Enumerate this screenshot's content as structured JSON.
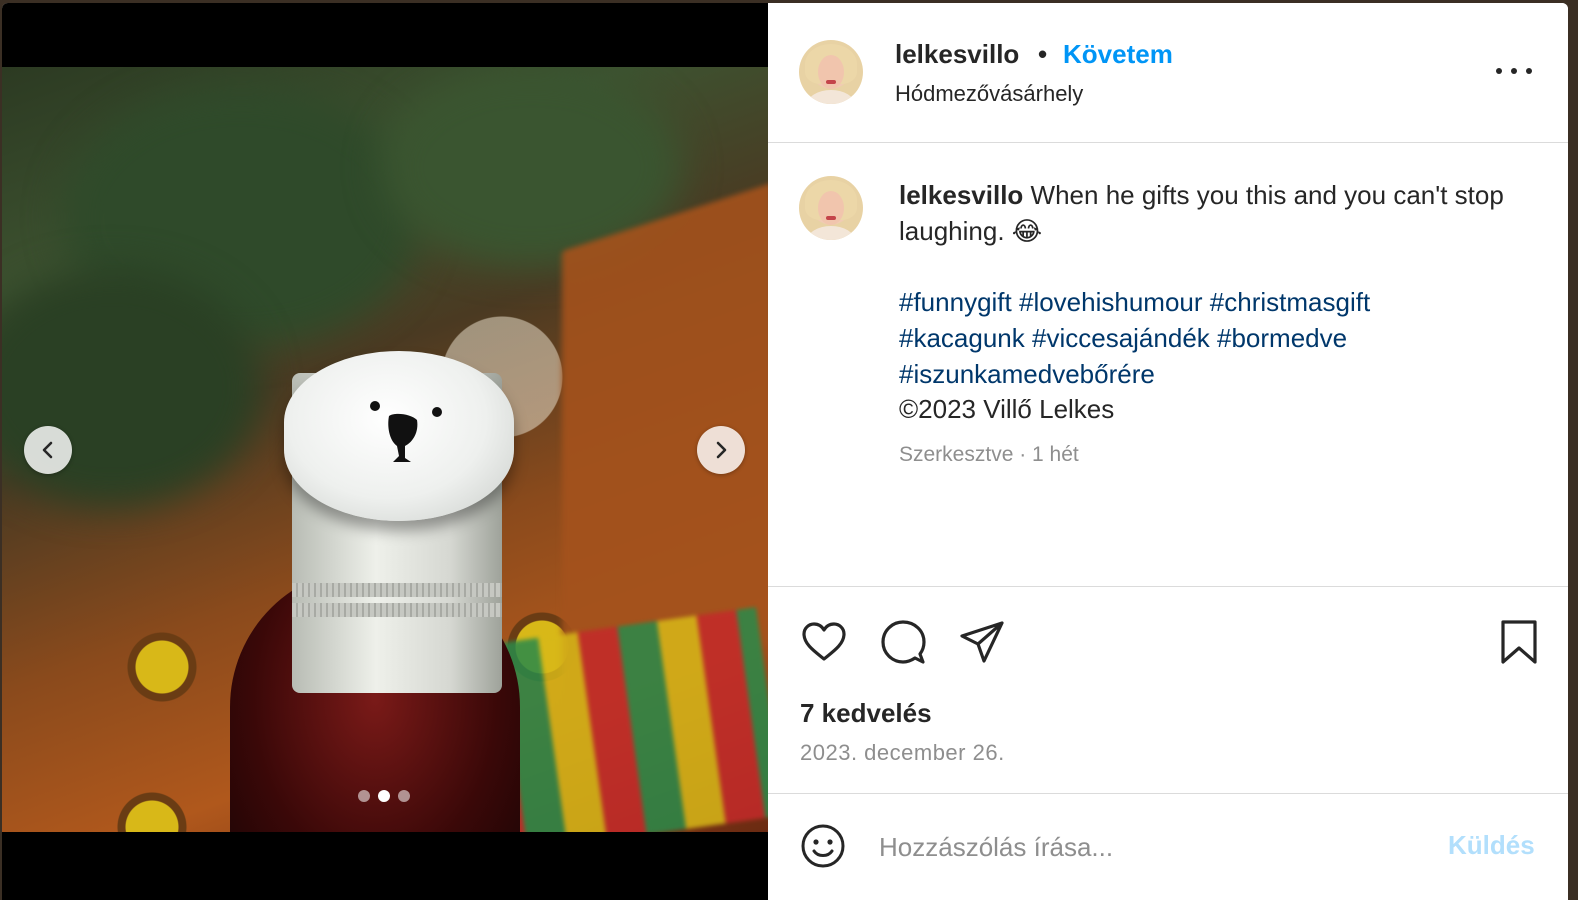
{
  "post": {
    "username": "lelkesvillo",
    "separator": "•",
    "follow_label": "Követem",
    "location": "Hódmezővásárhely",
    "caption_text": "When he gifts you this and you can't stop laughing. 😂",
    "hashtags": [
      "#funnygift",
      "#lovehishumour",
      "#christmasgift",
      "#kacagunk",
      "#viccesajándék",
      "#bormedve",
      "#iszunkamedvebőrére"
    ],
    "copyright": "©2023 Villő Lelkes",
    "edited_meta": "Szerkesztve · 1 hét",
    "likes": "7 kedvelés",
    "date": "2023. december 26."
  },
  "carousel": {
    "total": 3,
    "active_index": 1
  },
  "comment": {
    "placeholder": "Hozzászólás írása...",
    "send_label": "Küldés"
  },
  "icons": {
    "prev": "chevron-left-icon",
    "next": "chevron-right-icon",
    "more": "more-options-icon",
    "like": "heart-icon",
    "comment": "comment-bubble-icon",
    "share": "send-paper-plane-icon",
    "save": "bookmark-icon",
    "emoji": "smiley-icon"
  },
  "colors": {
    "accent": "#0095f6",
    "hashtag": "#00376b",
    "send_disabled": "#b2dffc"
  }
}
